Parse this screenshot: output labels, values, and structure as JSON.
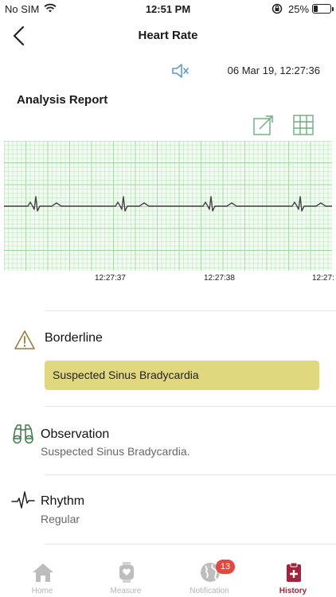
{
  "status_bar": {
    "carrier": "No SIM",
    "time": "12:51 PM",
    "battery_percent": "25%",
    "battery_level": 0.25
  },
  "nav": {
    "back_icon": "chevron-left-icon",
    "title": "Heart Rate"
  },
  "record": {
    "speaker_icon": "speaker-icon",
    "timestamp": "06 Mar 19, 12:27:36"
  },
  "analysis": {
    "title": "Analysis Report",
    "expand_icon": "expand-icon",
    "grid_icon": "grid-icon"
  },
  "ecg": {
    "time_labels": [
      "12:27:37",
      "12:27:38",
      "12:27:"
    ],
    "grid_color": "#9fd99f",
    "trace_color": "#444444"
  },
  "findings": {
    "borderline": {
      "label": "Borderline",
      "detail": "Suspected Sinus Bradycardia",
      "icon": "warning-icon",
      "icon_color": "#9a7b3a",
      "box_color": "#e0d77e"
    },
    "observation": {
      "label": "Observation",
      "value": "Suspected Sinus Bradycardia.",
      "icon": "binoculars-icon",
      "icon_color": "#3d7a4a"
    },
    "rhythm": {
      "label": "Rhythm",
      "value": "Regular",
      "icon": "pulse-icon"
    }
  },
  "tabbar": {
    "home": "Home",
    "measure": "Measure",
    "notification": "Notification",
    "notification_badge": "13",
    "history": "History",
    "active_color": "#a3243a",
    "inactive_color": "#b5b5b5"
  }
}
